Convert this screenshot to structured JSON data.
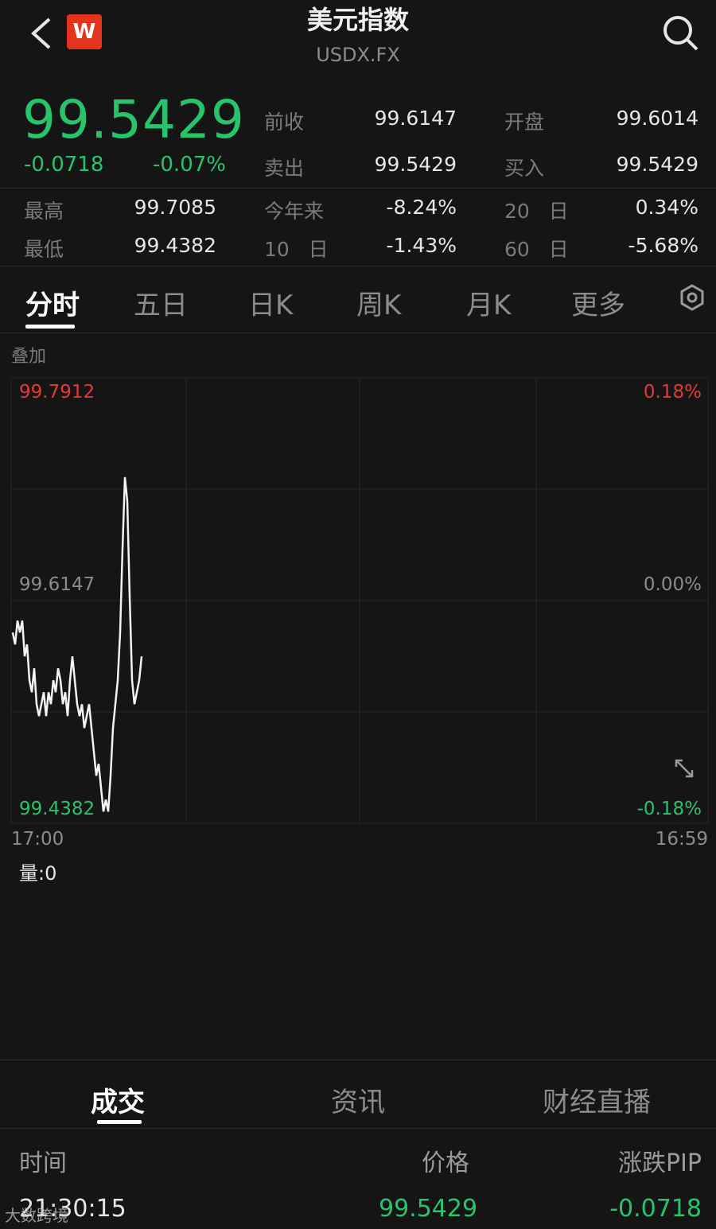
{
  "header": {
    "title": "美元指数",
    "symbol": "USDX.FX",
    "logo_letter": "W",
    "icons": {
      "back": "back-chevron-icon",
      "search": "search-icon",
      "settings": "settings-icon",
      "expand": "expand-icon"
    }
  },
  "quote": {
    "price": "99.5429",
    "change": "-0.0718",
    "change_pct": "-0.07%",
    "stats": {
      "prev_close_label": "前收",
      "prev_close": "99.6147",
      "open_label": "开盘",
      "open": "99.6014",
      "ask_label": "卖出",
      "ask": "99.5429",
      "bid_label": "买入",
      "bid": "99.5429",
      "high_label": "最高",
      "high": "99.7085",
      "ytd_label": "今年来",
      "ytd": "-8.24%",
      "d20_num": "20",
      "d20_unit": "日",
      "d20": "0.34%",
      "low_label": "最低",
      "low": "99.4382",
      "d10_num": "10",
      "d10_unit": "日",
      "d10": "-1.43%",
      "d60_num": "60",
      "d60_unit": "日",
      "d60": "-5.68%"
    }
  },
  "chart_tabs": [
    "分时",
    "五日",
    "日K",
    "周K",
    "月K",
    "更多"
  ],
  "overlay_label": "叠加",
  "chart_axes": {
    "y_top": "99.7912",
    "y_mid": "99.6147",
    "y_bottom": "99.4382",
    "pct_top": "0.18%",
    "pct_mid": "0.00%",
    "pct_bottom": "-0.18%",
    "time_start": "17:00",
    "time_end": "16:59"
  },
  "volume_label": "量:0",
  "bottom_tabs": [
    "成交",
    "资讯",
    "财经直播"
  ],
  "trades": {
    "headers": {
      "time": "时间",
      "price": "价格",
      "pip": "涨跌PIP"
    },
    "rows": [
      {
        "time": "21:30:15",
        "price": "99.5429",
        "pip": "-0.0718"
      }
    ]
  },
  "watermark": "大数跨境",
  "colors": {
    "up": "#e53935",
    "down": "#27c46b",
    "background": "#151515",
    "logo": "#e5341e"
  },
  "chart_data": {
    "type": "line",
    "ylim": [
      99.4382,
      99.7912
    ],
    "x_range": [
      "17:00",
      "16:59"
    ],
    "grid": true,
    "series": [
      {
        "values": [
          99.59,
          99.58,
          99.6,
          99.59,
          99.6,
          99.57,
          99.58,
          99.55,
          99.54,
          99.56,
          99.53,
          99.52,
          99.53,
          99.54,
          99.52,
          99.54,
          99.53,
          99.55,
          99.54,
          99.56,
          99.55,
          99.53,
          99.54,
          99.52,
          99.55,
          99.57,
          99.55,
          99.53,
          99.52,
          99.53,
          99.51,
          99.52,
          99.53,
          99.51,
          99.49,
          99.47,
          99.48,
          99.46,
          99.44,
          99.45,
          99.44,
          99.47,
          99.51,
          99.53,
          99.55,
          99.59,
          99.66,
          99.72,
          99.7,
          99.62,
          99.55,
          99.53,
          99.54,
          99.55,
          99.57
        ]
      }
    ]
  }
}
